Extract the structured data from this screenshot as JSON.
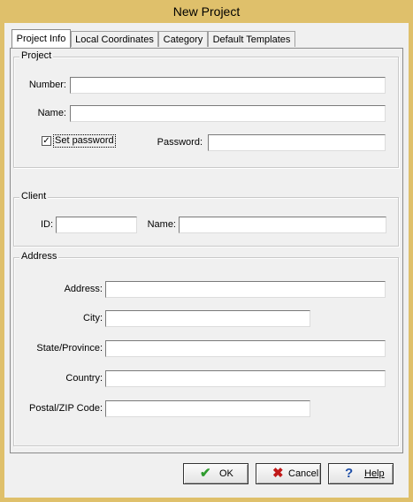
{
  "window": {
    "title": "New Project"
  },
  "tabs": [
    {
      "label": "Project Info"
    },
    {
      "label": "Local Coordinates"
    },
    {
      "label": "Category"
    },
    {
      "label": "Default Templates"
    }
  ],
  "project": {
    "group_title": "Project",
    "number_label": "Number:",
    "number_value": "",
    "name_label": "Name:",
    "name_value": "",
    "set_password_label": "Set password",
    "set_password_checked": true,
    "password_label": "Password:",
    "password_value": ""
  },
  "client": {
    "group_title": "Client",
    "id_label": "ID:",
    "id_value": "",
    "name_label": "Name:",
    "name_value": ""
  },
  "address": {
    "group_title": "Address",
    "address_label": "Address:",
    "address_value": "",
    "city_label": "City:",
    "city_value": "",
    "state_label": "State/Province:",
    "state_value": "",
    "country_label": "Country:",
    "country_value": "",
    "postal_label": "Postal/ZIP Code:",
    "postal_value": ""
  },
  "buttons": {
    "ok_label": "OK",
    "cancel_label": "Cancel",
    "help_label": "Help",
    "ok_icon": "checkmark-icon",
    "cancel_icon": "x-icon",
    "help_icon": "question-icon"
  },
  "colors": {
    "title_bar": "#dfc06b",
    "ok_icon": "#2e9b2e",
    "cancel_icon": "#c01818",
    "help_icon": "#1f4fa8"
  }
}
